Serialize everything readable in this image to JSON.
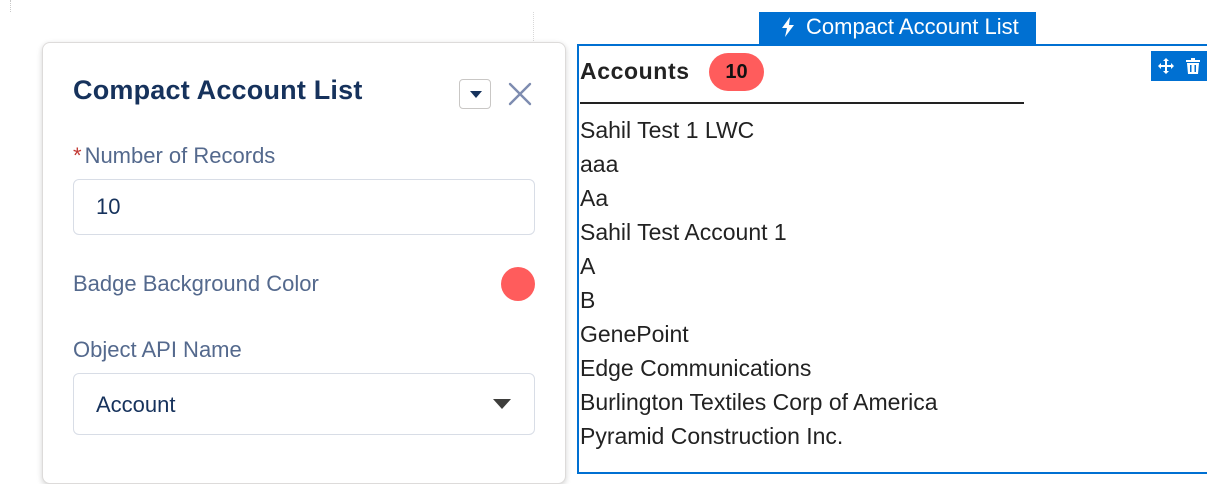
{
  "panel": {
    "title": "Compact Account List",
    "menu_icon": "chevron-down-icon",
    "close_icon": "close-icon",
    "fields": {
      "records": {
        "required_mark": "*",
        "label": "Number of Records",
        "value": "10"
      },
      "badge_color": {
        "label": "Badge Background Color",
        "color": "#ff5c5c"
      },
      "object": {
        "label": "Object API Name",
        "value": "Account",
        "icon": "chevron-down-icon"
      }
    }
  },
  "component": {
    "tab_label": "Compact Account List",
    "tab_icon": "lightning-bolt-icon",
    "tools": [
      "move-icon",
      "delete-icon"
    ],
    "header": {
      "title": "Accounts",
      "badge_count": "10",
      "badge_color": "#ff5c5c"
    },
    "accounts": [
      "Sahil Test 1 LWC",
      "aaa",
      "Aa",
      "Sahil Test Account 1",
      "A",
      "B",
      "GenePoint",
      "Edge Communications",
      "Burlington Textiles Corp of America",
      "Pyramid Construction Inc."
    ]
  },
  "colors": {
    "accent": "#0070d2",
    "heading": "#16325c",
    "label": "#54698d"
  }
}
